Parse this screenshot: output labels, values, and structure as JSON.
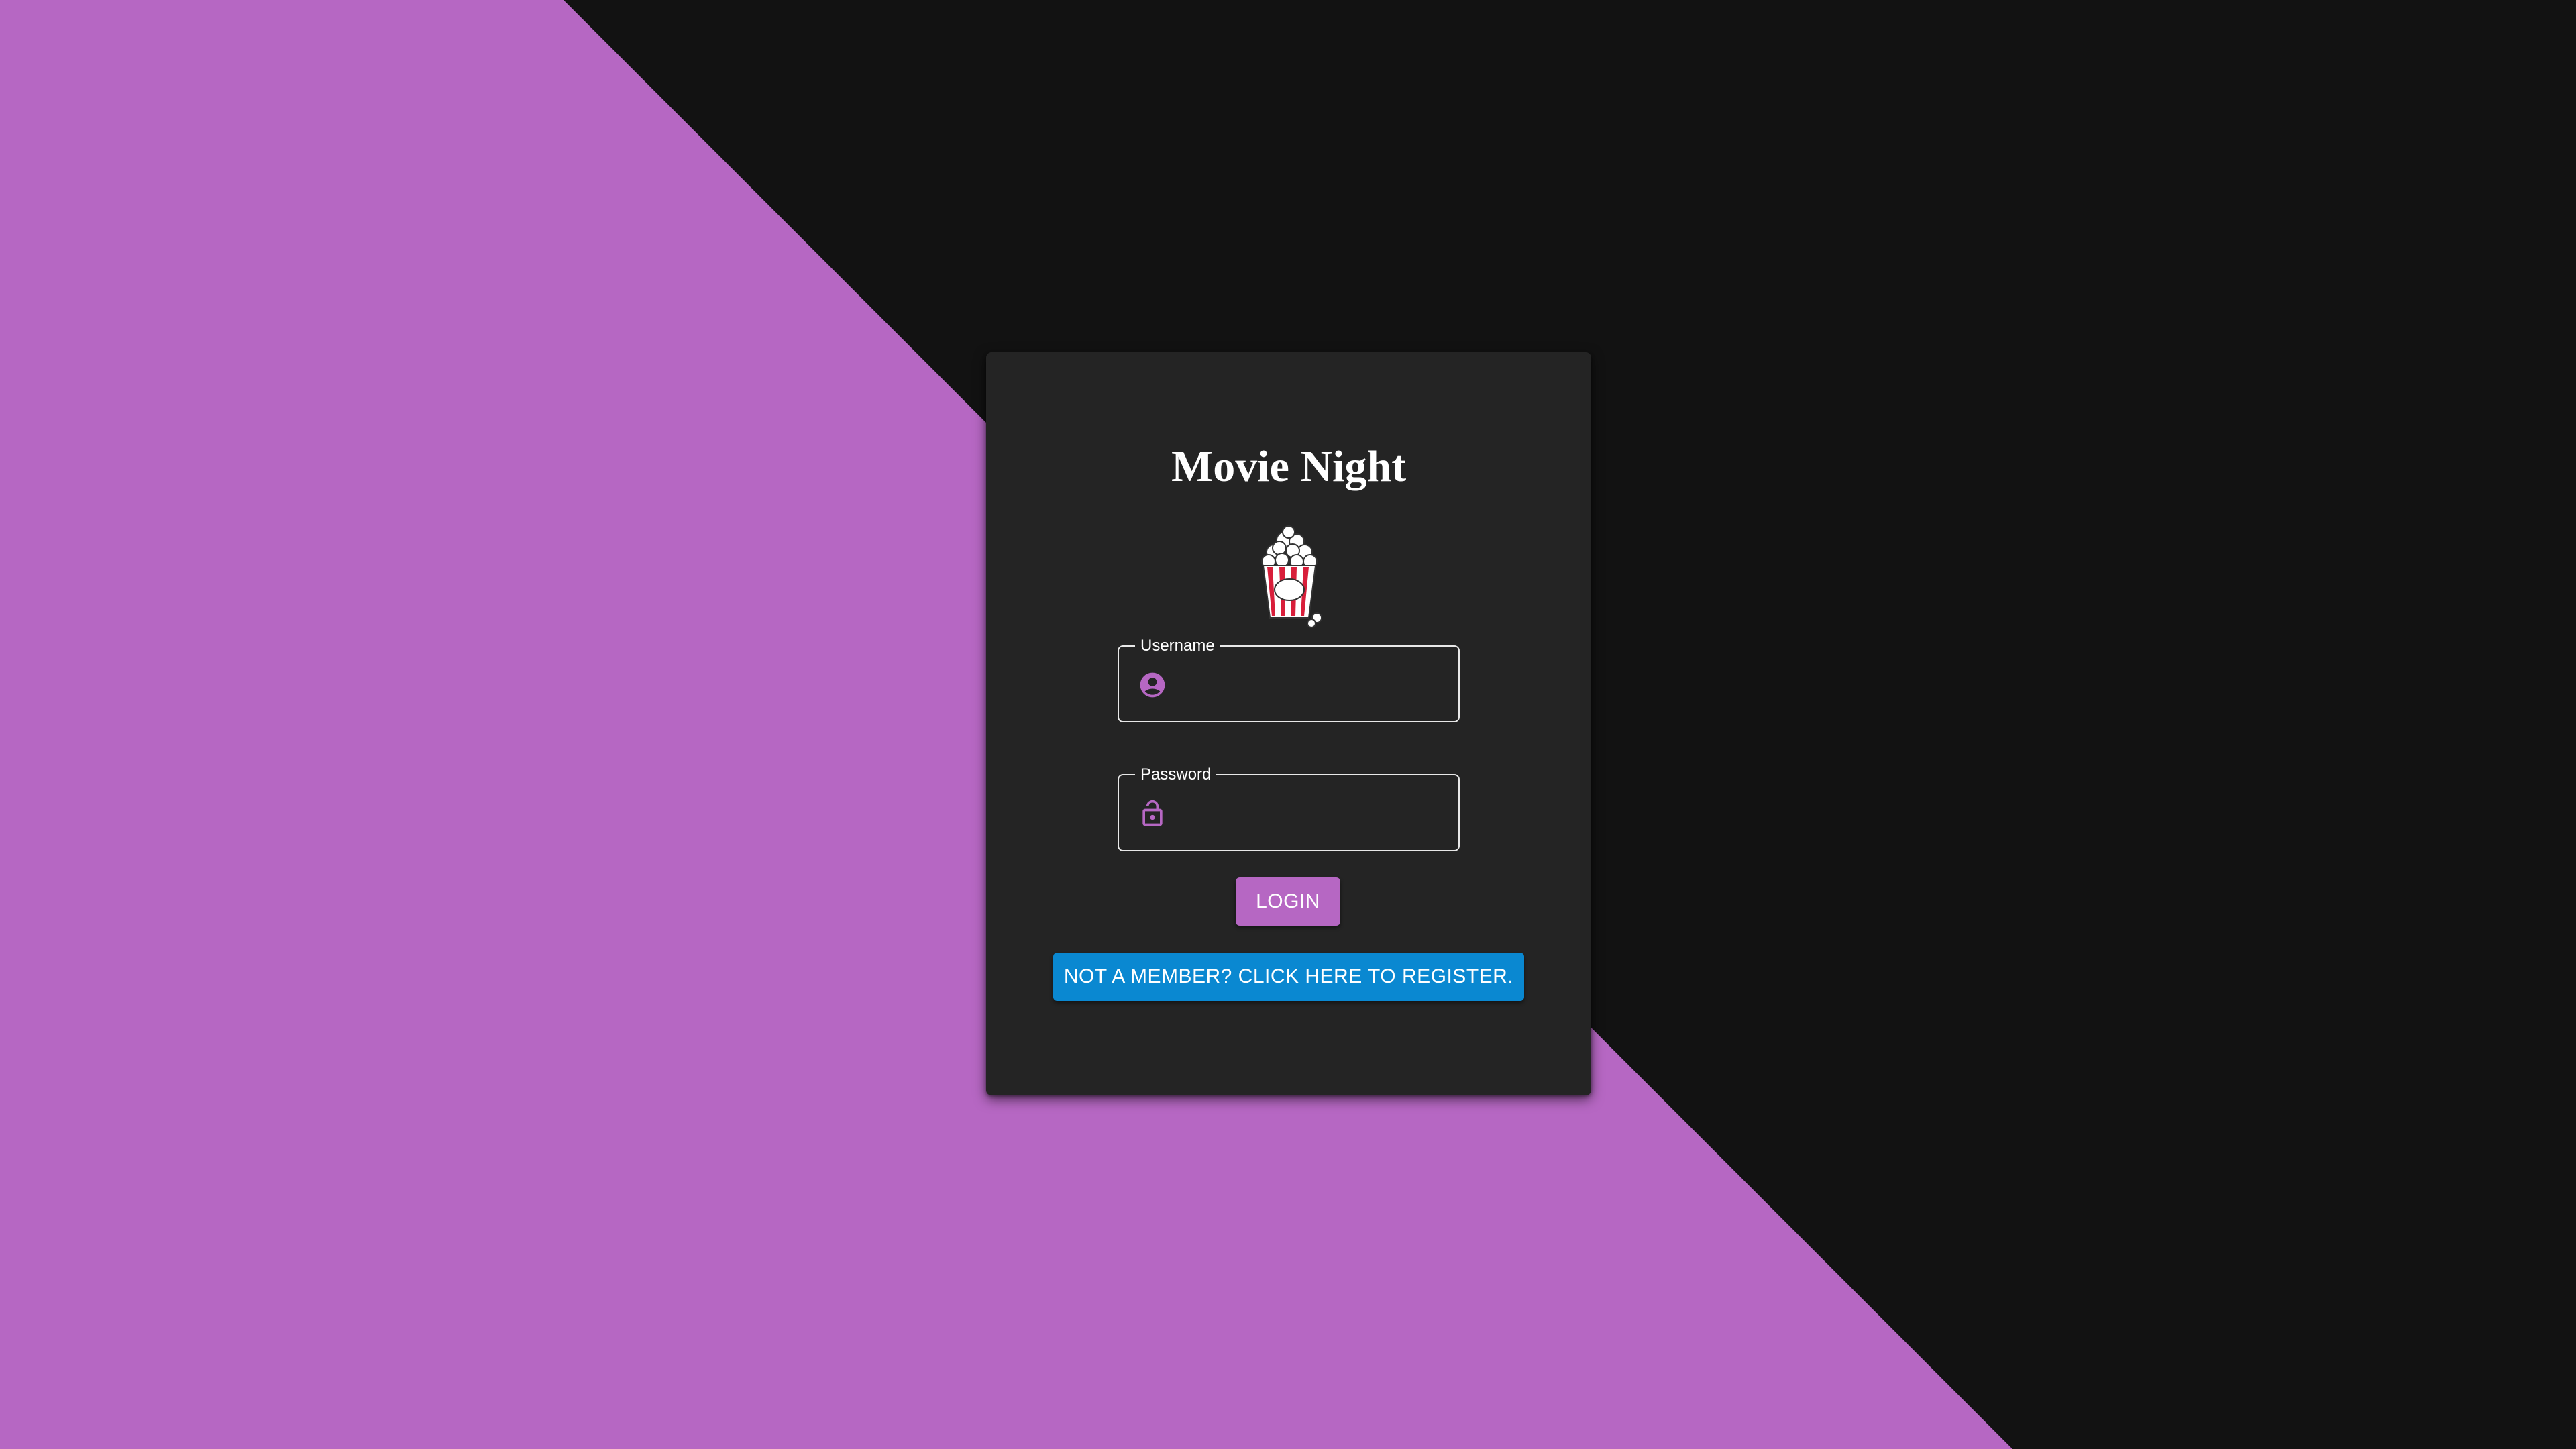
{
  "colors": {
    "accent": "#b667c3",
    "dark_background": "#121212",
    "card_background": "#242424",
    "register_button": "#0a88d1",
    "text": "#ffffff"
  },
  "login_card": {
    "title": "Movie Night",
    "logo": "popcorn-icon",
    "username_field": {
      "label": "Username",
      "value": "",
      "icon": "account-circle-icon"
    },
    "password_field": {
      "label": "Password",
      "value": "",
      "icon": "lock-open-icon"
    },
    "login_button_label": "LOGIN",
    "register_button_label": "NOT A MEMBER? CLICK HERE TO REGISTER."
  }
}
